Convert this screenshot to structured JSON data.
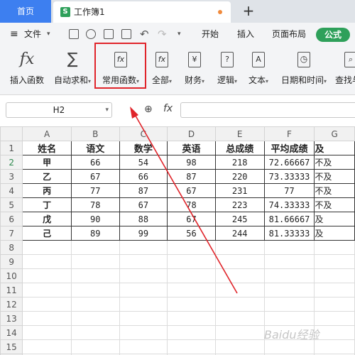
{
  "tabs": {
    "home": "首页",
    "doc_icon": "S",
    "doc_title": "工作簿1",
    "new_tab": "+"
  },
  "menu": {
    "file": "文件",
    "start": "开始",
    "insert": "插入",
    "layout": "页面布局",
    "formula": "公式"
  },
  "ribbon": {
    "insert_function": "插入函数",
    "autosum": "自动求和",
    "common_functions": "常用函数",
    "all": "全部",
    "finance": "财务",
    "logic": "逻辑",
    "text": "文本",
    "datetime": "日期和时间",
    "lookup": "查找与"
  },
  "formula_bar": {
    "name_box": "H2",
    "fx": "fx"
  },
  "sheet": {
    "columns": [
      "A",
      "B",
      "C",
      "D",
      "E",
      "F",
      "G"
    ],
    "selected_cell": "H2",
    "rows": [
      [
        "姓名",
        "语文",
        "数学",
        "英语",
        "总成绩",
        "平均成绩",
        "及"
      ],
      [
        "甲",
        "66",
        "54",
        "98",
        "218",
        "72.66667",
        "不及"
      ],
      [
        "乙",
        "67",
        "66",
        "87",
        "220",
        "73.33333",
        "不及"
      ],
      [
        "丙",
        "77",
        "87",
        "67",
        "231",
        "77",
        "不及"
      ],
      [
        "丁",
        "78",
        "67",
        "78",
        "223",
        "74.33333",
        "不及"
      ],
      [
        "戊",
        "90",
        "88",
        "67",
        "245",
        "81.66667",
        "及"
      ],
      [
        "己",
        "89",
        "99",
        "56",
        "244",
        "81.33333",
        "及"
      ]
    ],
    "total_rows": 16
  },
  "watermark": "Baidu经验",
  "colors": {
    "accent_blue": "#3d7ff0",
    "accent_green": "#2ea05a",
    "annotation_red": "#e0242a"
  }
}
